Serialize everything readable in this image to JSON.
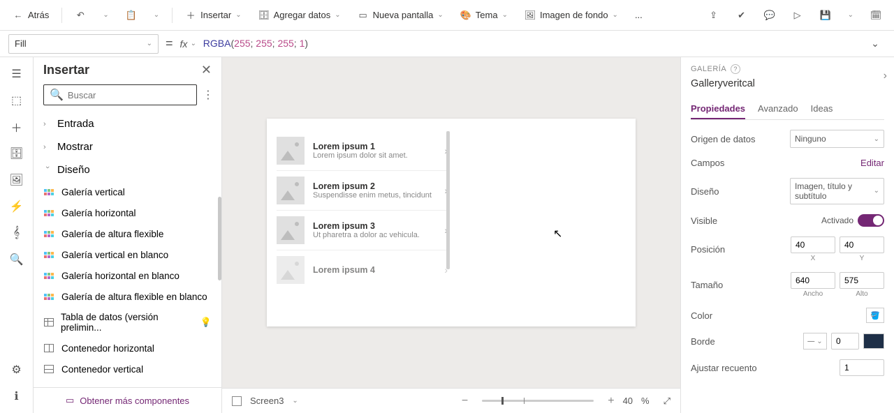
{
  "cmdbar": {
    "back": "Atrás",
    "insert": "Insertar",
    "addData": "Agregar datos",
    "newScreen": "Nueva pantalla",
    "theme": "Tema",
    "bgImage": "Imagen de fondo",
    "overflow": "..."
  },
  "fx": {
    "property": "Fill",
    "fn": "RGBA",
    "a1": "255",
    "a2": "255",
    "a3": "255",
    "a4": "1"
  },
  "insertPane": {
    "title": "Insertar",
    "searchPlaceholder": "Buscar",
    "cats": {
      "entrada": "Entrada",
      "mostrar": "Mostrar",
      "diseno": "Diseño"
    },
    "items": [
      "Galería vertical",
      "Galería horizontal",
      "Galería de altura flexible",
      "Galería vertical en blanco",
      "Galería horizontal en blanco",
      "Galería de altura flexible en blanco",
      "Tabla de datos (versión prelimin...",
      "Contenedor horizontal",
      "Contenedor vertical"
    ],
    "getMore": "Obtener más componentes"
  },
  "gallery": [
    {
      "t": "Lorem ipsum 1",
      "s": "Lorem ipsum dolor sit amet."
    },
    {
      "t": "Lorem ipsum 2",
      "s": "Suspendisse enim metus, tincidunt"
    },
    {
      "t": "Lorem ipsum 3",
      "s": "Ut pharetra a dolor ac vehicula."
    },
    {
      "t": "Lorem ipsum 4",
      "s": ""
    }
  ],
  "footer": {
    "screen": "Screen3",
    "zoom": "40",
    "zoomUnit": "%"
  },
  "props": {
    "section": "GALERÍA",
    "name": "Galleryveritcal",
    "tabs": {
      "p": "Propiedades",
      "a": "Avanzado",
      "i": "Ideas"
    },
    "dataSource": {
      "lbl": "Origen de datos",
      "val": "Ninguno"
    },
    "fields": {
      "lbl": "Campos",
      "link": "Editar"
    },
    "layout": {
      "lbl": "Diseño",
      "val": "Imagen, título y subtítulo"
    },
    "visible": {
      "lbl": "Visible",
      "state": "Activado"
    },
    "position": {
      "lbl": "Posición",
      "x": "40",
      "y": "40",
      "xc": "X",
      "yc": "Y"
    },
    "size": {
      "lbl": "Tamaño",
      "w": "640",
      "h": "575",
      "wc": "Ancho",
      "hc": "Alto"
    },
    "color": {
      "lbl": "Color"
    },
    "border": {
      "lbl": "Borde",
      "val": "0"
    },
    "wrap": {
      "lbl": "Ajustar recuento",
      "val": "1"
    }
  }
}
